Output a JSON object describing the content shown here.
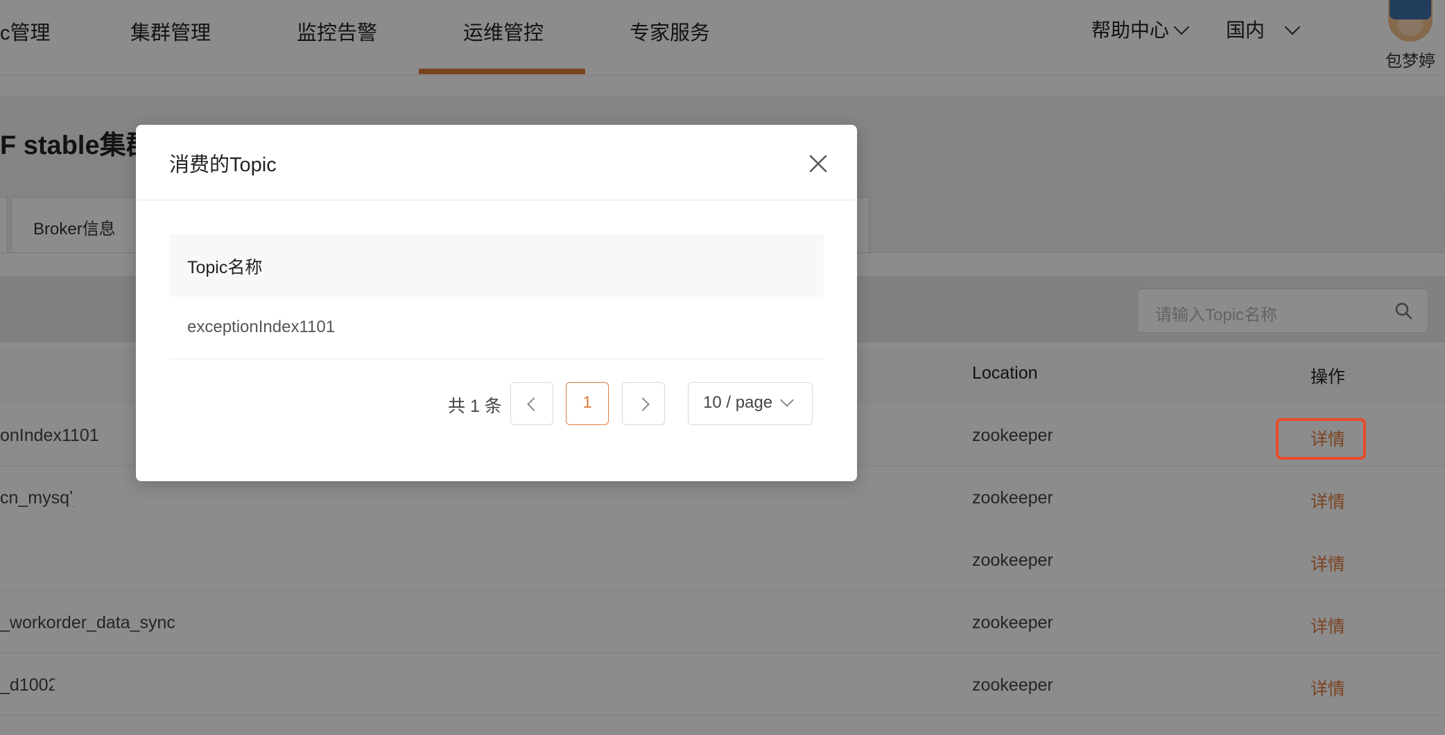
{
  "nav": {
    "items": [
      "c管理",
      "集群管理",
      "监控告警",
      "运维管控",
      "专家服务"
    ],
    "help": "帮助中心",
    "region": "国内",
    "user_name": "包梦婷"
  },
  "page": {
    "title": "F stable集群",
    "tab_broker": "Broker信息",
    "search_placeholder": "请输入Topic名称"
  },
  "table": {
    "col_location": "Location",
    "col_action": "操作",
    "rows": [
      {
        "topic": "onIndex1101",
        "location": "zookeeper",
        "action": "详情"
      },
      {
        "topic": "cn_mysql_",
        "location": "zookeeper",
        "action": "详情"
      },
      {
        "topic": "",
        "location": "zookeeper",
        "action": "详情"
      },
      {
        "topic": "_workorder_data_sync",
        "location": "zookeeper",
        "action": "详情"
      },
      {
        "topic": "_d1002",
        "location": "zookeeper",
        "action": "详情"
      }
    ]
  },
  "modal": {
    "title": "消费的Topic",
    "col_topic": "Topic名称",
    "rows": [
      "exceptionIndex1101"
    ],
    "total": "共 1 条",
    "current_page": "1",
    "page_size": "10 / page"
  },
  "colors": {
    "accent": "#e07a3c",
    "highlight_border": "#ea4a2a"
  }
}
